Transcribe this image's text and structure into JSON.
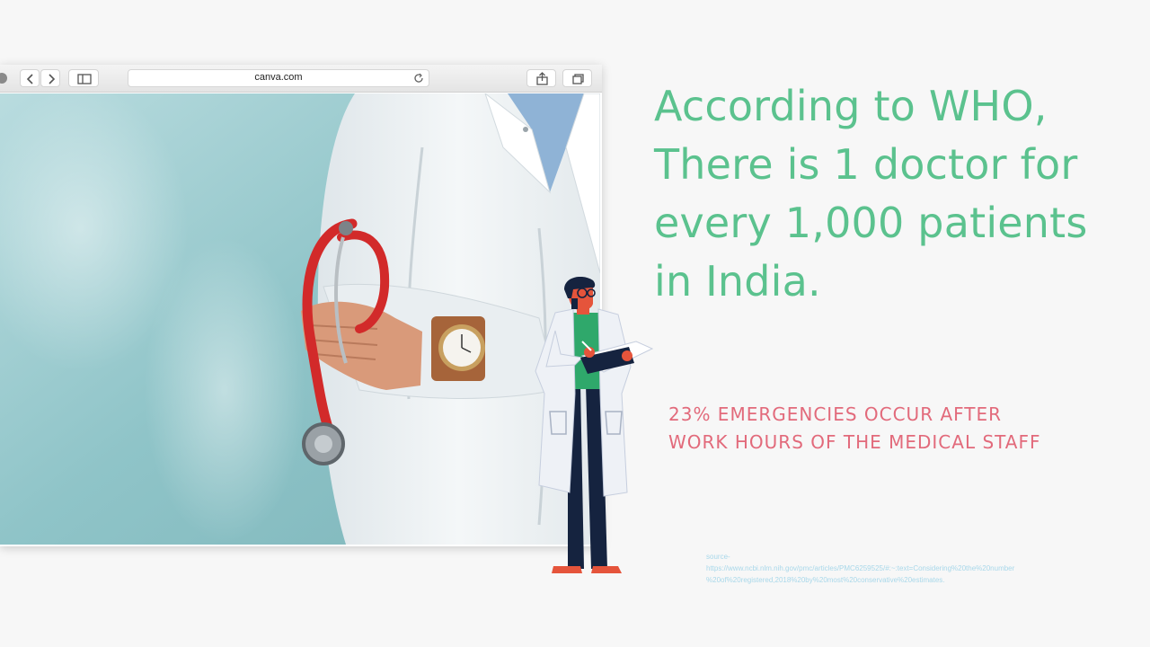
{
  "browser": {
    "url": "canva.com",
    "icons": [
      "back-icon",
      "forward-icon",
      "sidebar-icon",
      "reload-icon",
      "share-icon",
      "tabs-icon"
    ]
  },
  "headline": {
    "lines": [
      "According to WHO,",
      "There is 1 doctor for",
      "every 1,000 patients",
      "in India."
    ]
  },
  "stat": {
    "lines": [
      "23% EMERGENCIES OCCUR AFTER",
      "WORK HOURS OF THE MEDICAL STAFF"
    ]
  },
  "source": {
    "lines": [
      "source-",
      "https://www.ncbi.nlm.nih.gov/pmc/articles/PMC6259525/#:~:text=Considering%20the%20number",
      "%20of%20registered,2018%20by%20most%20conservative%20estimates."
    ]
  },
  "colors": {
    "headline": "#5bc28e",
    "stat": "#e26a7b",
    "source": "#a9d8ea",
    "background": "#f7f7f7"
  }
}
